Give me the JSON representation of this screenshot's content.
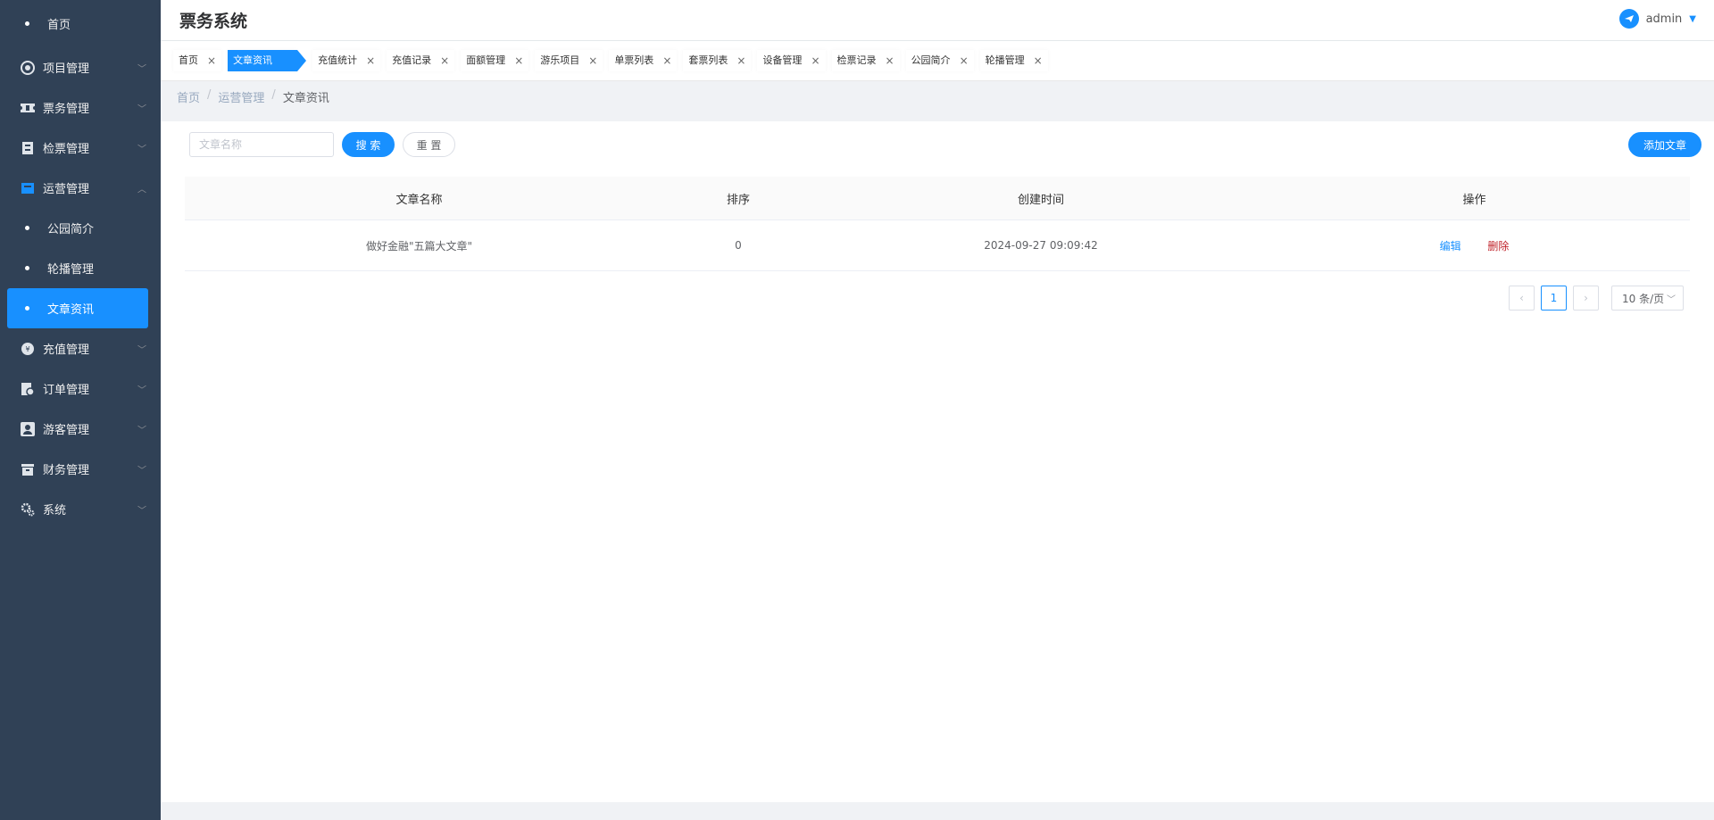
{
  "app": {
    "title": "票务系统"
  },
  "user": {
    "name": "admin"
  },
  "sidebar": {
    "home": "首页",
    "groups": [
      {
        "label": "项目管理",
        "icon": "project-icon"
      },
      {
        "label": "票务管理",
        "icon": "ticket-icon"
      },
      {
        "label": "检票管理",
        "icon": "check-ticket-icon"
      },
      {
        "label": "运营管理",
        "icon": "operation-icon",
        "expanded": true,
        "children": [
          "公园简介",
          "轮播管理",
          "文章资讯"
        ]
      },
      {
        "label": "充值管理",
        "icon": "recharge-icon"
      },
      {
        "label": "订单管理",
        "icon": "order-icon"
      },
      {
        "label": "游客管理",
        "icon": "visitor-icon"
      },
      {
        "label": "财务管理",
        "icon": "finance-icon"
      },
      {
        "label": "系统",
        "icon": "system-gear-icon"
      }
    ],
    "active": "文章资讯",
    "accent": "#1890ff"
  },
  "tags": [
    "首页",
    "文章资讯",
    "充值统计",
    "充值记录",
    "面额管理",
    "游乐项目",
    "单票列表",
    "套票列表",
    "设备管理",
    "检票记录",
    "公园简介",
    "轮播管理"
  ],
  "breadcrumb": [
    "首页",
    "运营管理",
    "文章资讯"
  ],
  "search": {
    "placeholder": "文章名称",
    "search_label": "搜 索",
    "reset_label": "重 置",
    "add_label": "添加文章"
  },
  "table": {
    "headers": [
      "文章名称",
      "排序",
      "创建时间",
      "操作"
    ],
    "rows": [
      {
        "name": "做好金融\"五篇大文章\"",
        "order": "0",
        "created": "2024-09-27 09:09:42"
      }
    ],
    "actions": {
      "edit": "编辑",
      "delete": "删除"
    }
  },
  "pagination": {
    "current_page": "1",
    "page_size": "10 条/页"
  }
}
